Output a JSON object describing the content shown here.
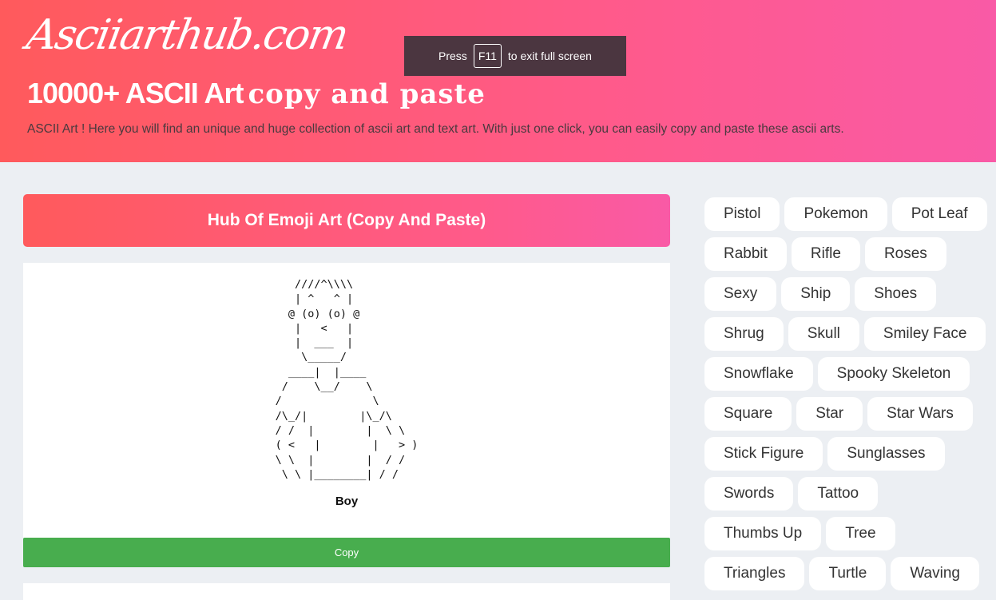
{
  "header": {
    "logo_text": "Asciiarthub.com",
    "headline_bold": "10000+ ASCII Art",
    "headline_serif": "copy and paste",
    "tagline": "ASCII Art ! Here you will find an unique and huge collection of ascii art and text art. With just one click, you can easily copy and paste these ascii arts.",
    "gradient_start": "#ff5a5c",
    "gradient_end": "#f95aa6"
  },
  "fullscreen_notice": {
    "prefix": "Press",
    "key": "F11",
    "suffix": "to exit full screen"
  },
  "main": {
    "title": "Hub Of Emoji Art (Copy And Paste)",
    "art": {
      "text": "   ////^\\\\\\\\\n   | ^   ^ |\n  @ (o) (o) @\n   |   <   |\n   |  ___  |\n    \\_____/\n  ____|  |____\n /    \\__/    \\\n/              \\\n/\\_/|        |\\_/\\\n/ /  |        |  \\ \\\n( <   |        |   > )\n\\ \\  |        |  / /\n \\ \\ |________| / /",
      "name": "Boy"
    },
    "copy_label": "Copy",
    "copy_color": "#48ad4e"
  },
  "sidebar": {
    "tags": [
      "Pistol",
      "Pokemon",
      "Pot Leaf",
      "Rabbit",
      "Rifle",
      "Roses",
      "Sexy",
      "Ship",
      "Shoes",
      "Shrug",
      "Skull",
      "Smiley Face",
      "Snowflake",
      "Spooky Skeleton",
      "Square",
      "Star",
      "Star Wars",
      "Stick Figure",
      "Sunglasses",
      "Swords",
      "Tattoo",
      "Thumbs Up",
      "Tree",
      "Triangles",
      "Turtle",
      "Waving"
    ]
  }
}
